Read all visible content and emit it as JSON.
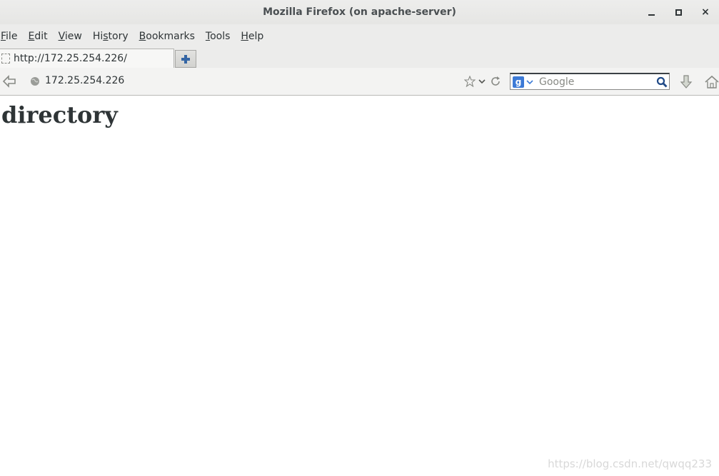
{
  "window": {
    "title": "Mozilla Firefox (on apache-server)",
    "close_glyph": "×"
  },
  "menubar": {
    "items": [
      {
        "key": "F",
        "rest": "ile"
      },
      {
        "key": "E",
        "rest": "dit"
      },
      {
        "key": "V",
        "rest": "iew"
      },
      {
        "pre": "Hi",
        "key": "s",
        "rest": "tory"
      },
      {
        "key": "B",
        "rest": "ookmarks"
      },
      {
        "key": "T",
        "rest": "ools"
      },
      {
        "key": "H",
        "rest": "elp"
      }
    ]
  },
  "tabs": {
    "active_title": "http://172.25.254.226/"
  },
  "navbar": {
    "url": "172.25.254.226",
    "search_placeholder": "Google",
    "search_engine_glyph": "g"
  },
  "content": {
    "heading": "directory"
  },
  "watermark": "https://blog.csdn.net/qwqq233",
  "icons": {
    "back": "back-arrow-icon",
    "site": "globe-icon",
    "bookmark": "star-icon",
    "reload": "reload-icon",
    "search_go": "magnifier-icon",
    "downloads": "download-icon",
    "home": "home-icon"
  },
  "colors": {
    "chrome_bg": "#ececeb",
    "text": "#2e3436",
    "accent_blue": "#3c7ad6"
  }
}
